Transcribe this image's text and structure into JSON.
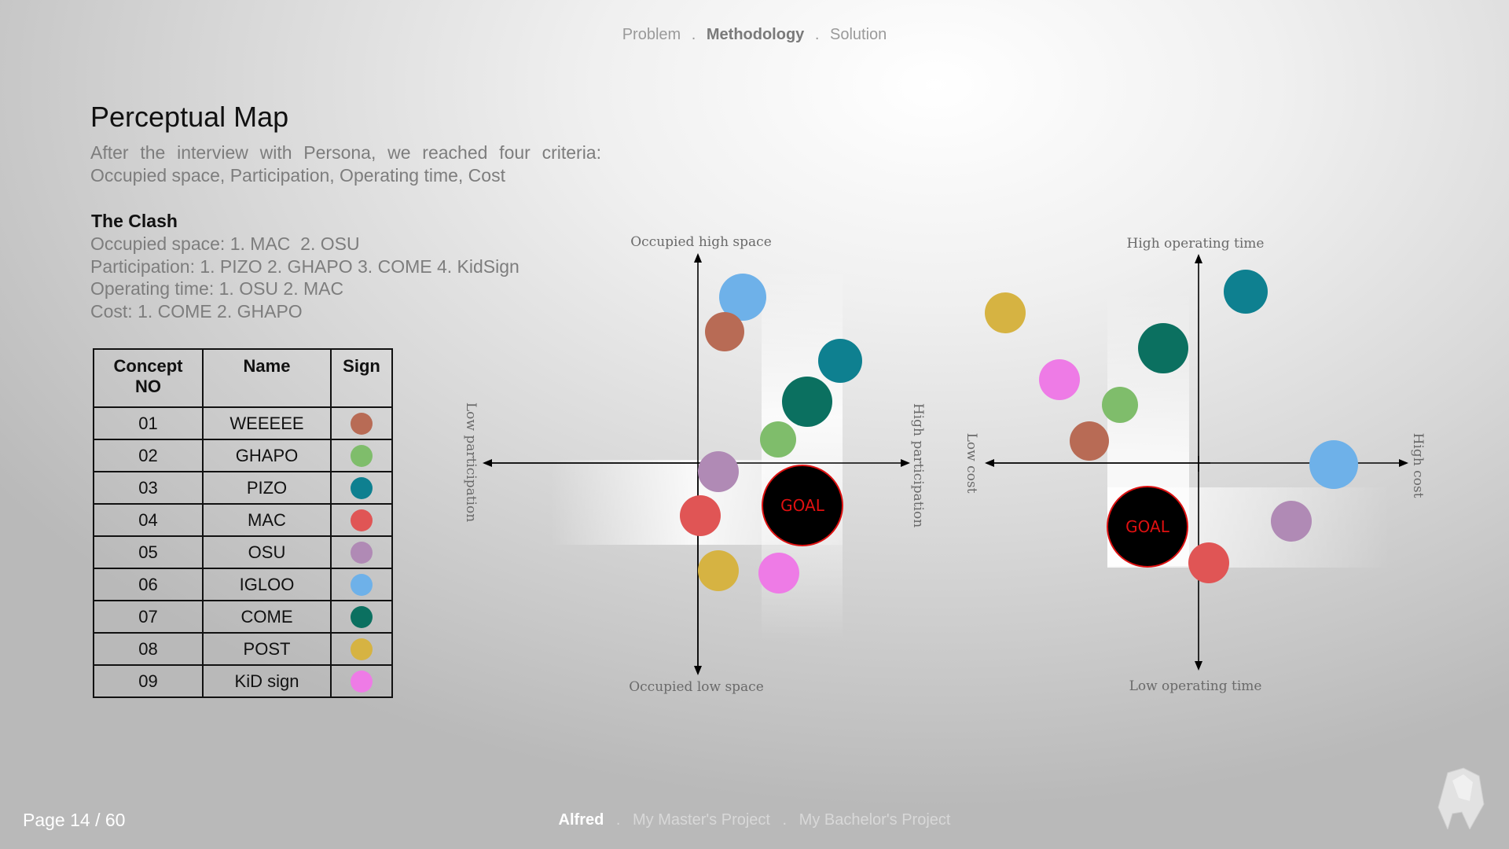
{
  "nav": {
    "items": [
      {
        "label": "Problem"
      },
      {
        "label": "Methodology"
      },
      {
        "label": "Solution"
      }
    ],
    "sep": "."
  },
  "title": "Perceptual Map",
  "intro": {
    "line1": "After the interview with Persona, we reached four criteria:",
    "line2": "Occupied space, Participation, Operating time, Cost"
  },
  "clash": {
    "title": "The Clash",
    "lines": [
      "Occupied space: 1. MAC  2. OSU",
      "Participation: 1. PIZO 2. GHAPO 3. COME 4. KidSign",
      "Operating time: 1. OSU 2. MAC",
      "Cost: 1. COME 2. GHAPO"
    ]
  },
  "table": {
    "headers": [
      "Concept NO",
      "Name",
      "Sign"
    ],
    "rows": [
      {
        "no": "01",
        "name": "WEEEEE",
        "color": "#b86b55"
      },
      {
        "no": "02",
        "name": "GHAPO",
        "color": "#7fbd6b"
      },
      {
        "no": "03",
        "name": "PIZO",
        "color": "#0e8090"
      },
      {
        "no": "04",
        "name": "MAC",
        "color": "#e05555"
      },
      {
        "no": "05",
        "name": "OSU",
        "color": "#b08ab5"
      },
      {
        "no": "06",
        "name": "IGLOO",
        "color": "#6eb1e9"
      },
      {
        "no": "07",
        "name": "COME",
        "color": "#0b7060"
      },
      {
        "no": "08",
        "name": "POST",
        "color": "#d6b342"
      },
      {
        "no": "09",
        "name": "KiD sign",
        "color": "#ee7be6"
      }
    ]
  },
  "map1": {
    "top": "Occupied high space",
    "bottom": "Occupied low space",
    "left": "Low participation",
    "right": "High participation",
    "goal": "GOAL"
  },
  "map2": {
    "top": "High operating time",
    "bottom": "Low operating time",
    "left": "Low cost",
    "right": "High cost",
    "goal": "GOAL"
  },
  "footer": {
    "page": "Page 14 / 60",
    "links": [
      {
        "label": "Alfred"
      },
      {
        "label": "My Master's Project"
      },
      {
        "label": "My Bachelor's Project"
      }
    ],
    "sep": "."
  }
}
